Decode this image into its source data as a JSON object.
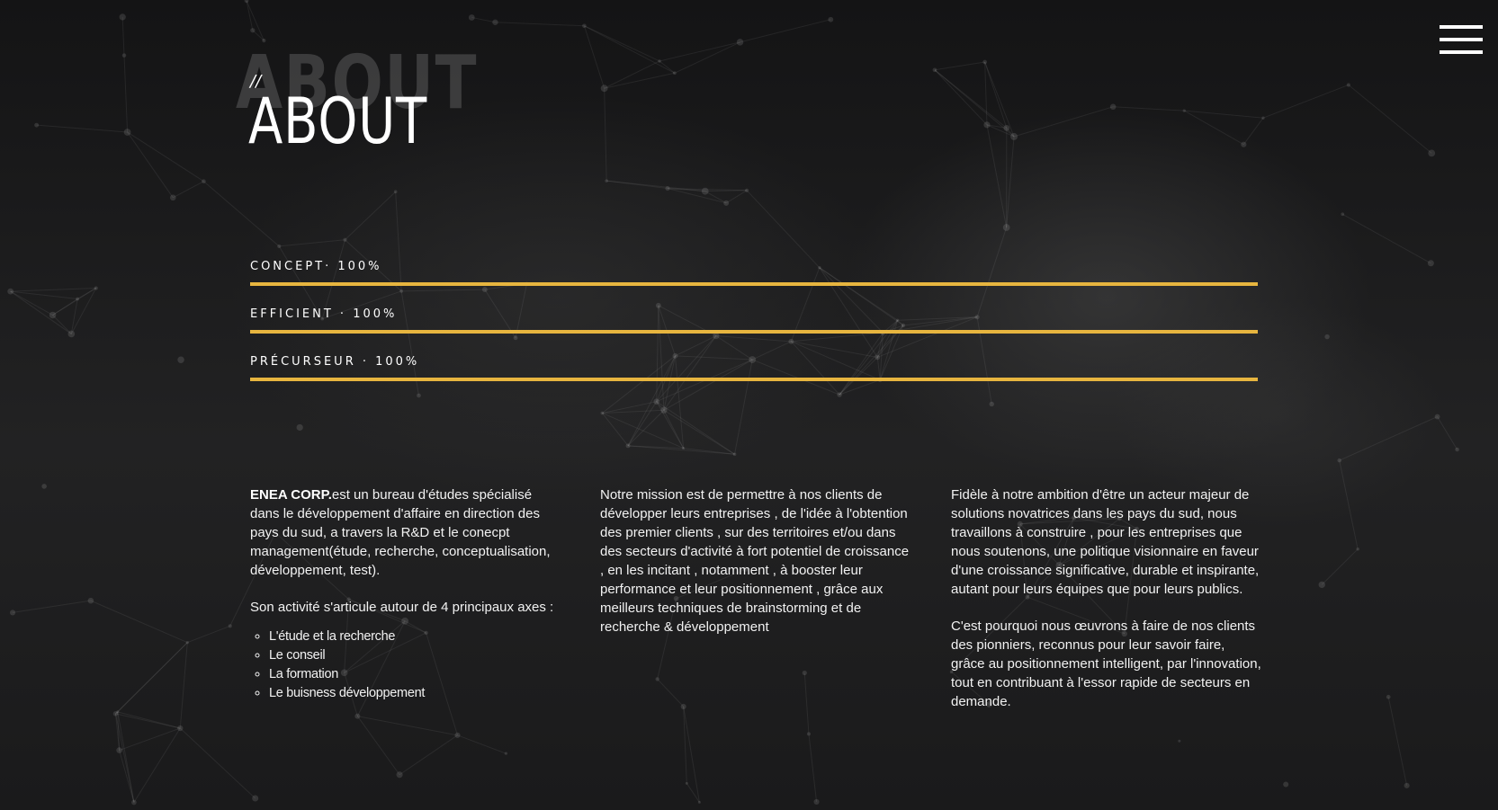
{
  "header": {
    "ghost_title": "ABOUT",
    "slashes": "//",
    "title": "ABOUT",
    "menu_icon": "hamburger-menu-icon"
  },
  "skills": [
    {
      "label": "CONCEPT· 100%",
      "value": 100
    },
    {
      "label": "EFFICIENT · 100%",
      "value": 100
    },
    {
      "label": "PRÉCURSEUR · 100%",
      "value": 100
    }
  ],
  "colors": {
    "accent": "#e7b53f",
    "background": "#1c1c1d",
    "text": "#f2f2f2"
  },
  "columns": {
    "left": {
      "brand": "ENEA CORP.",
      "intro": "est un bureau d'études spécialisé dans le développement d'affaire en direction des pays du sud, a travers la R&D et le conecpt management(étude, recherche, conceptualisation, développement, test).",
      "axes_intro": "Son activité s'articule autour de 4 principaux axes :",
      "axes": [
        "L'étude et la recherche",
        "Le conseil",
        "La formation",
        "Le buisness développement"
      ]
    },
    "middle": {
      "text": "Notre mission est de permettre à nos clients de développer leurs entreprises , de l'idée à l'obtention des premier clients , sur des territoires et/ou dans des secteurs d'activité à fort potentiel de croissance , en les incitant , notamment , à booster leur performance et leur positionnement , grâce aux meilleurs techniques de brainstorming et de recherche & développement"
    },
    "right": {
      "p1": "Fidèle à notre ambition d'être un acteur majeur de solutions novatrices dans les pays du sud, nous travaillons à construire , pour les entreprises que nous soutenons, une politique visionnaire en faveur d'une croissance significative, durable et inspirante, autant pour leurs équipes que pour leurs publics.",
      "p2": "C'est pourquoi nous œuvrons à faire de nos clients des pionniers, reconnus pour leur savoir faire, grâce au positionnement intelligent, par l'innovation, tout en contribuant à l'essor rapide de secteurs en demande."
    }
  }
}
